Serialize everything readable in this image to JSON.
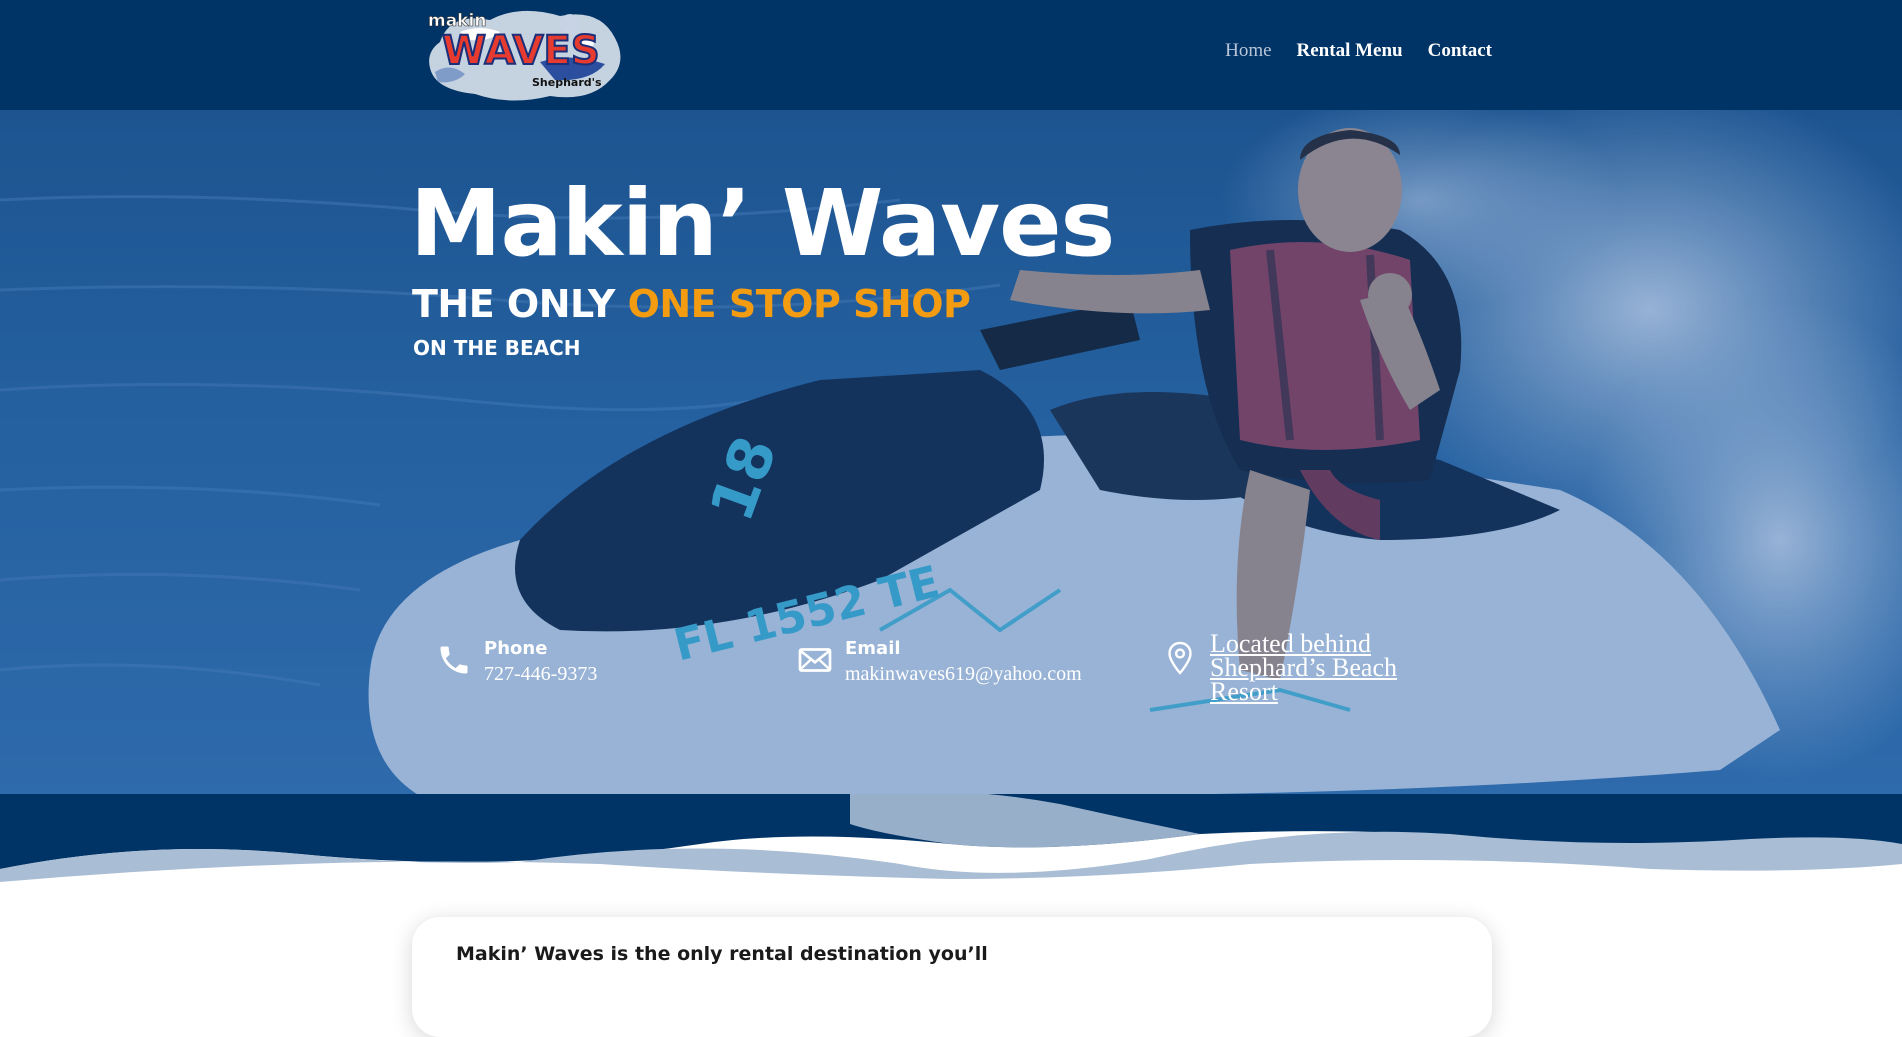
{
  "header": {
    "logo": {
      "brand_small": "makin",
      "brand_main": "WAVES",
      "brand_sub": "Shephard's",
      "icon": "makin-waves-logo"
    },
    "nav": [
      {
        "label": "Home",
        "active": true
      },
      {
        "label": "Rental Menu",
        "active": false
      },
      {
        "label": "Contact",
        "active": false
      }
    ]
  },
  "hero": {
    "title": "Makin’ Waves",
    "subtitle_prefix": "THE ONLY ",
    "subtitle_accent": "ONE STOP SHOP",
    "tagline": "ON THE BEACH",
    "jetski_number": "18",
    "jetski_registration": "FL 1552 TE",
    "contacts": {
      "phone": {
        "label": "Phone",
        "value": "727-446-9373",
        "icon": "phone-icon"
      },
      "email": {
        "label": "Email",
        "value": "makinwaves619@yahoo.com",
        "icon": "envelope-icon"
      },
      "location": {
        "value": "Located behind Shephard’s Beach Resort",
        "icon": "map-pin-icon"
      }
    }
  },
  "content": {
    "intro_text": "Makin’ Waves is the only rental destination you’ll"
  },
  "colors": {
    "navy": "#003366",
    "accent_orange": "#f39c12",
    "white": "#ffffff",
    "wave_light": "#a9bdd4"
  }
}
